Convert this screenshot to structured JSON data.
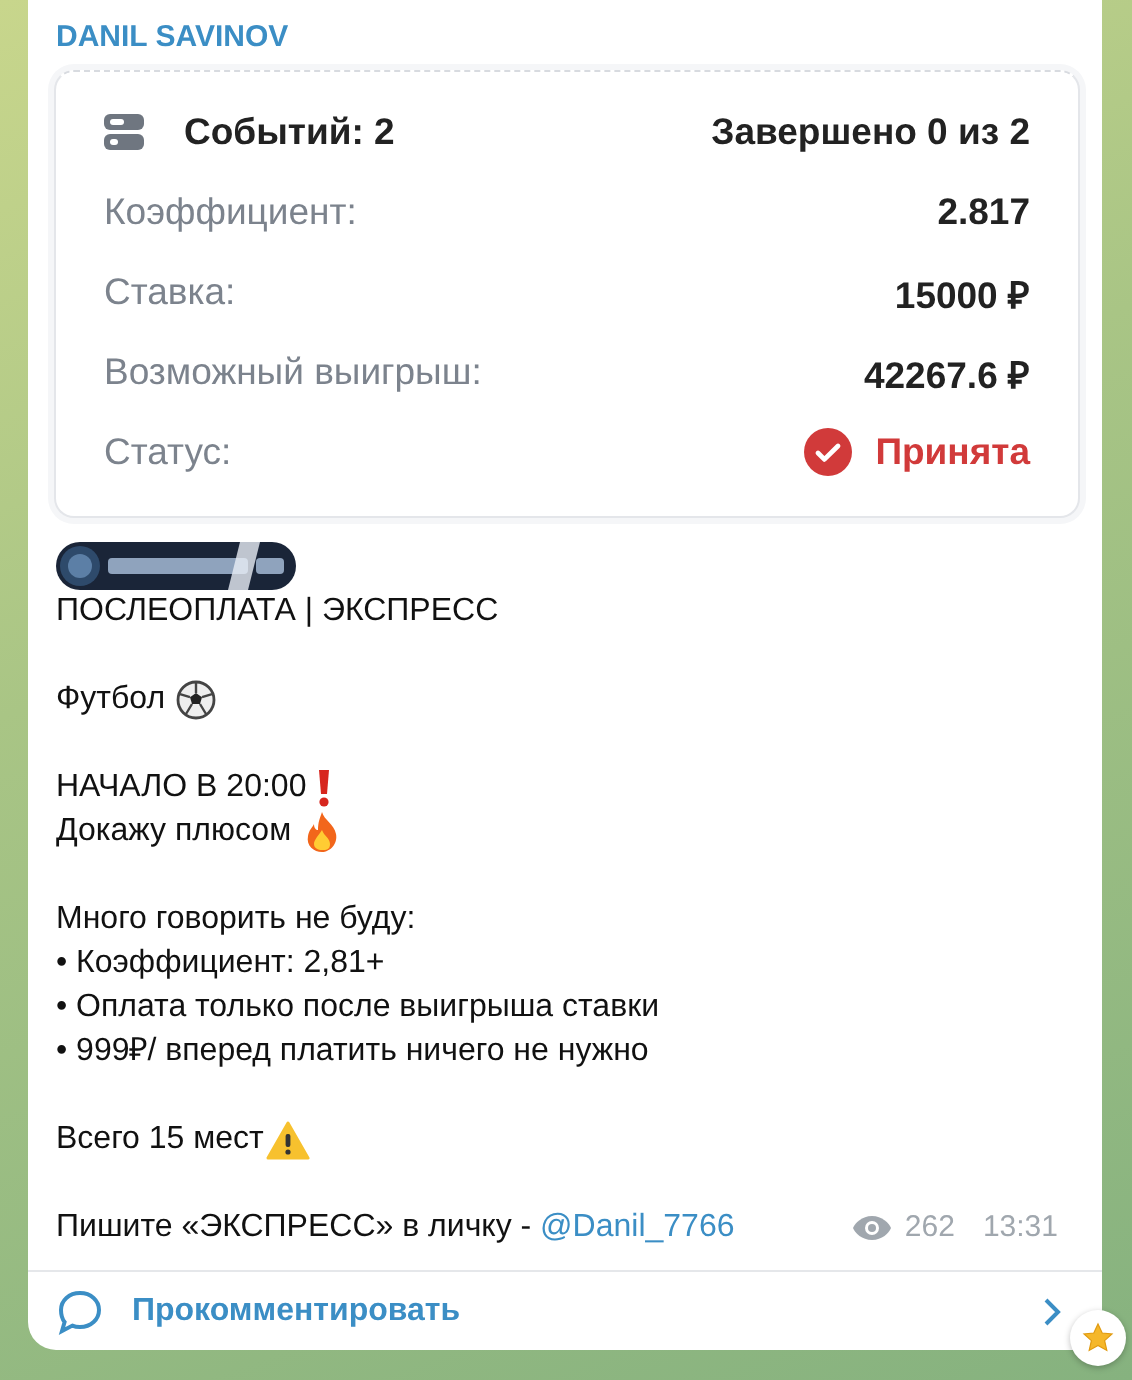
{
  "channel": {
    "name": "DANIL SAVINOV"
  },
  "bet_card": {
    "events": "Событий: 2",
    "progress": "Завершено 0 из 2",
    "rows": [
      {
        "label": "Коэффициент:",
        "value": "2.817"
      },
      {
        "label": "Ставка:",
        "value": "15000 ₽"
      },
      {
        "label": "Возможный выигрыш:",
        "value": "42267.6 ₽"
      }
    ],
    "status": {
      "label": "Статус:",
      "value": "Принята",
      "accepted": true
    }
  },
  "message": {
    "lines": [
      {
        "kind": "text",
        "text": "ПОСЛЕОПЛАТА | ЭКСПРЕСС"
      },
      {
        "kind": "blank"
      },
      {
        "kind": "text",
        "text": "Футбол"
      },
      {
        "kind": "blank"
      },
      {
        "kind": "text",
        "text": "НАЧАЛО В 20:00"
      },
      {
        "kind": "text",
        "text": "Докажу плюсом"
      },
      {
        "kind": "blank"
      },
      {
        "kind": "text",
        "text": "Много говорить не буду:"
      },
      {
        "kind": "text",
        "text": "• Коэффициент: 2,81+"
      },
      {
        "kind": "text",
        "text": "• Оплата только после выигрыша ставки"
      },
      {
        "kind": "text",
        "text": "• 999₽/ вперед платить ничего не нужно"
      },
      {
        "kind": "blank"
      },
      {
        "kind": "text",
        "text": "Всего 15 мест"
      },
      {
        "kind": "blank"
      }
    ],
    "last_line": {
      "text": "Пишите «ЭКСПРЕСС» в личку - ",
      "link": "@Danil_7766"
    },
    "views": "262",
    "time": "13:31"
  },
  "comment_button": {
    "label": "Прокомментировать"
  }
}
